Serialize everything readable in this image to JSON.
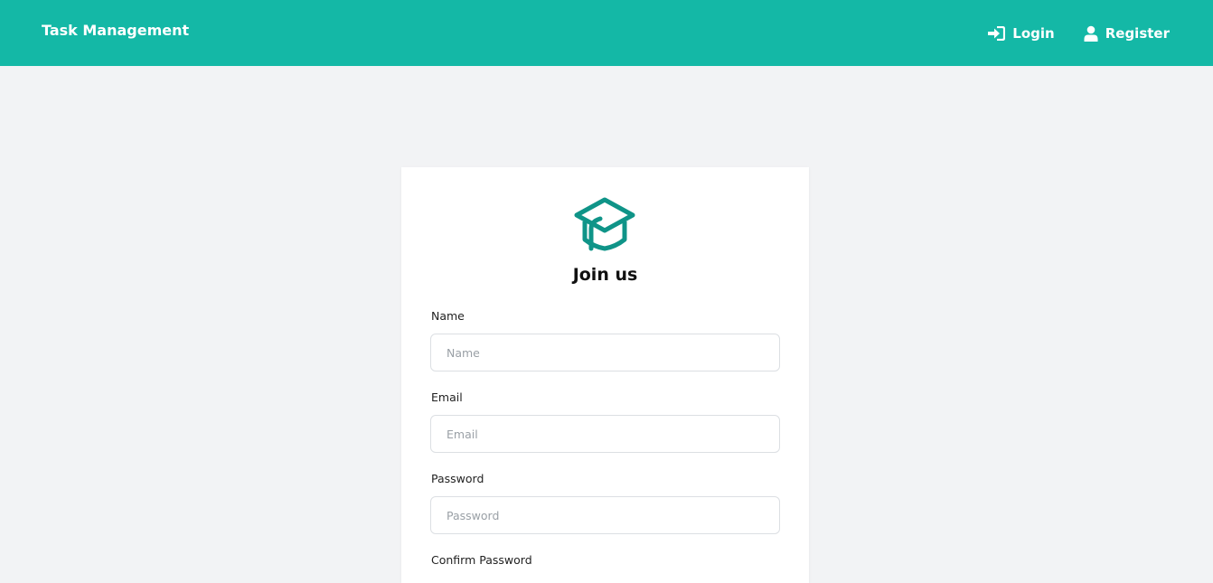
{
  "navbar": {
    "brand": "Task Management",
    "login_label": "Login",
    "register_label": "Register",
    "color": "#14b8a6"
  },
  "card": {
    "icon": "graduation-cap-icon",
    "title": "Join us",
    "fields": {
      "name": {
        "label": "Name",
        "placeholder": "Name"
      },
      "email": {
        "label": "Email",
        "placeholder": "Email"
      },
      "password": {
        "label": "Password",
        "placeholder": "Password"
      },
      "confirm_password": {
        "label": "Confirm Password"
      }
    }
  },
  "colors": {
    "accent": "#14b8a6",
    "logo": "#0f9488",
    "background": "#f2f3f5"
  }
}
